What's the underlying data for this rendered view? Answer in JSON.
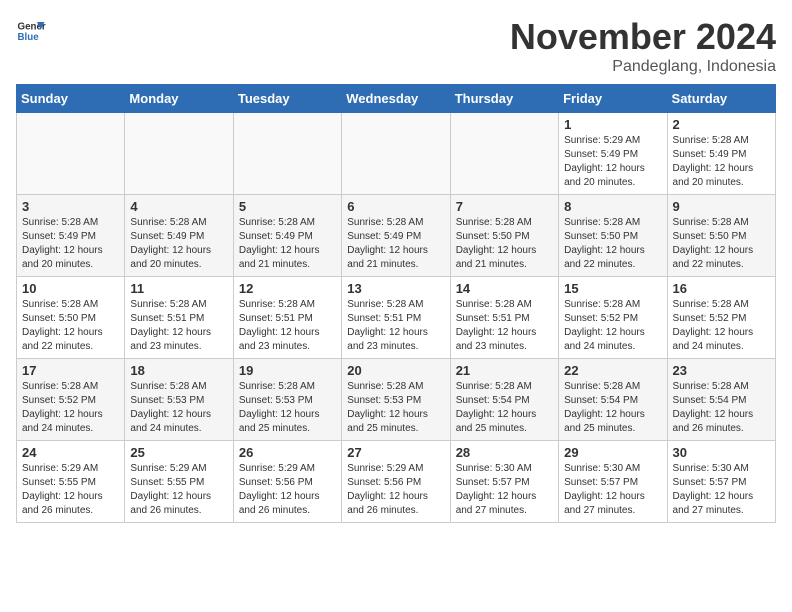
{
  "logo": {
    "line1": "General",
    "line2": "Blue"
  },
  "title": "November 2024",
  "location": "Pandeglang, Indonesia",
  "days_of_week": [
    "Sunday",
    "Monday",
    "Tuesday",
    "Wednesday",
    "Thursday",
    "Friday",
    "Saturday"
  ],
  "weeks": [
    [
      {
        "day": "",
        "info": ""
      },
      {
        "day": "",
        "info": ""
      },
      {
        "day": "",
        "info": ""
      },
      {
        "day": "",
        "info": ""
      },
      {
        "day": "",
        "info": ""
      },
      {
        "day": "1",
        "info": "Sunrise: 5:29 AM\nSunset: 5:49 PM\nDaylight: 12 hours\nand 20 minutes."
      },
      {
        "day": "2",
        "info": "Sunrise: 5:28 AM\nSunset: 5:49 PM\nDaylight: 12 hours\nand 20 minutes."
      }
    ],
    [
      {
        "day": "3",
        "info": "Sunrise: 5:28 AM\nSunset: 5:49 PM\nDaylight: 12 hours\nand 20 minutes."
      },
      {
        "day": "4",
        "info": "Sunrise: 5:28 AM\nSunset: 5:49 PM\nDaylight: 12 hours\nand 20 minutes."
      },
      {
        "day": "5",
        "info": "Sunrise: 5:28 AM\nSunset: 5:49 PM\nDaylight: 12 hours\nand 21 minutes."
      },
      {
        "day": "6",
        "info": "Sunrise: 5:28 AM\nSunset: 5:49 PM\nDaylight: 12 hours\nand 21 minutes."
      },
      {
        "day": "7",
        "info": "Sunrise: 5:28 AM\nSunset: 5:50 PM\nDaylight: 12 hours\nand 21 minutes."
      },
      {
        "day": "8",
        "info": "Sunrise: 5:28 AM\nSunset: 5:50 PM\nDaylight: 12 hours\nand 22 minutes."
      },
      {
        "day": "9",
        "info": "Sunrise: 5:28 AM\nSunset: 5:50 PM\nDaylight: 12 hours\nand 22 minutes."
      }
    ],
    [
      {
        "day": "10",
        "info": "Sunrise: 5:28 AM\nSunset: 5:50 PM\nDaylight: 12 hours\nand 22 minutes."
      },
      {
        "day": "11",
        "info": "Sunrise: 5:28 AM\nSunset: 5:51 PM\nDaylight: 12 hours\nand 23 minutes."
      },
      {
        "day": "12",
        "info": "Sunrise: 5:28 AM\nSunset: 5:51 PM\nDaylight: 12 hours\nand 23 minutes."
      },
      {
        "day": "13",
        "info": "Sunrise: 5:28 AM\nSunset: 5:51 PM\nDaylight: 12 hours\nand 23 minutes."
      },
      {
        "day": "14",
        "info": "Sunrise: 5:28 AM\nSunset: 5:51 PM\nDaylight: 12 hours\nand 23 minutes."
      },
      {
        "day": "15",
        "info": "Sunrise: 5:28 AM\nSunset: 5:52 PM\nDaylight: 12 hours\nand 24 minutes."
      },
      {
        "day": "16",
        "info": "Sunrise: 5:28 AM\nSunset: 5:52 PM\nDaylight: 12 hours\nand 24 minutes."
      }
    ],
    [
      {
        "day": "17",
        "info": "Sunrise: 5:28 AM\nSunset: 5:52 PM\nDaylight: 12 hours\nand 24 minutes."
      },
      {
        "day": "18",
        "info": "Sunrise: 5:28 AM\nSunset: 5:53 PM\nDaylight: 12 hours\nand 24 minutes."
      },
      {
        "day": "19",
        "info": "Sunrise: 5:28 AM\nSunset: 5:53 PM\nDaylight: 12 hours\nand 25 minutes."
      },
      {
        "day": "20",
        "info": "Sunrise: 5:28 AM\nSunset: 5:53 PM\nDaylight: 12 hours\nand 25 minutes."
      },
      {
        "day": "21",
        "info": "Sunrise: 5:28 AM\nSunset: 5:54 PM\nDaylight: 12 hours\nand 25 minutes."
      },
      {
        "day": "22",
        "info": "Sunrise: 5:28 AM\nSunset: 5:54 PM\nDaylight: 12 hours\nand 25 minutes."
      },
      {
        "day": "23",
        "info": "Sunrise: 5:28 AM\nSunset: 5:54 PM\nDaylight: 12 hours\nand 26 minutes."
      }
    ],
    [
      {
        "day": "24",
        "info": "Sunrise: 5:29 AM\nSunset: 5:55 PM\nDaylight: 12 hours\nand 26 minutes."
      },
      {
        "day": "25",
        "info": "Sunrise: 5:29 AM\nSunset: 5:55 PM\nDaylight: 12 hours\nand 26 minutes."
      },
      {
        "day": "26",
        "info": "Sunrise: 5:29 AM\nSunset: 5:56 PM\nDaylight: 12 hours\nand 26 minutes."
      },
      {
        "day": "27",
        "info": "Sunrise: 5:29 AM\nSunset: 5:56 PM\nDaylight: 12 hours\nand 26 minutes."
      },
      {
        "day": "28",
        "info": "Sunrise: 5:30 AM\nSunset: 5:57 PM\nDaylight: 12 hours\nand 27 minutes."
      },
      {
        "day": "29",
        "info": "Sunrise: 5:30 AM\nSunset: 5:57 PM\nDaylight: 12 hours\nand 27 minutes."
      },
      {
        "day": "30",
        "info": "Sunrise: 5:30 AM\nSunset: 5:57 PM\nDaylight: 12 hours\nand 27 minutes."
      }
    ]
  ]
}
